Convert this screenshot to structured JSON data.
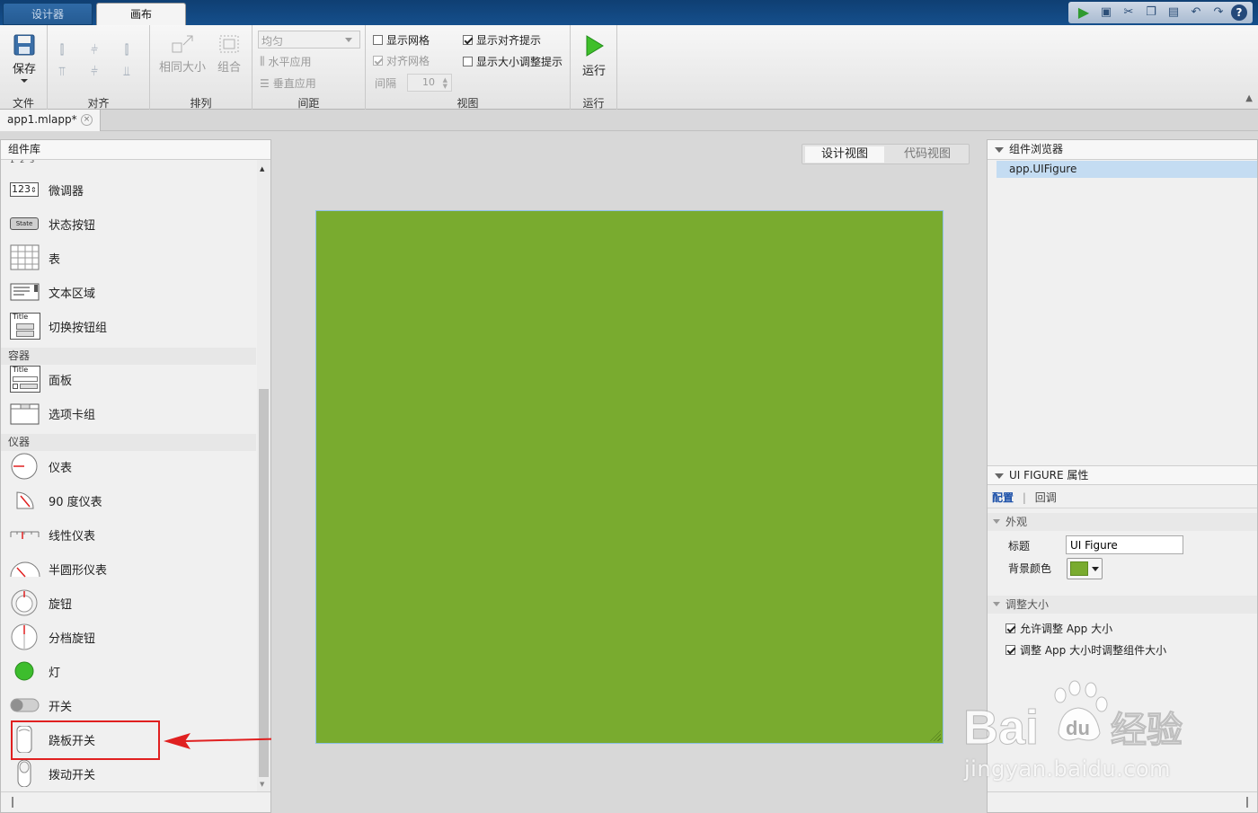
{
  "tabs": {
    "designer": "设计器",
    "canvas": "画布"
  },
  "ribbon": {
    "file": {
      "save": "保存",
      "group": "文件"
    },
    "align": {
      "group": "对齐"
    },
    "arrange": {
      "same_size": "相同大小",
      "group_btn": "组合",
      "group": "排列"
    },
    "spacing": {
      "even_dropdown": "均匀",
      "apply_horizontal": "水平应用",
      "apply_vertical": "垂直应用",
      "group": "间距"
    },
    "view": {
      "show_grid": "显示网格",
      "snap_grid": "对齐网格",
      "interval_label": "间隔",
      "interval_value": "10",
      "show_align_hints": "显示对齐提示",
      "show_resize_hints": "显示大小调整提示",
      "group": "视图"
    },
    "run": {
      "run": "运行",
      "group": "运行"
    }
  },
  "doc_tab": {
    "name": "app1.mlapp*"
  },
  "component_library": {
    "header": "组件库",
    "items_top": [
      {
        "label": "微调器",
        "icon": "spinner-icon"
      },
      {
        "label": "状态按钮",
        "icon": "state-button-icon",
        "icon_text": "State"
      },
      {
        "label": "表",
        "icon": "table-icon"
      },
      {
        "label": "文本区域",
        "icon": "text-area-icon"
      },
      {
        "label": "切换按钮组",
        "icon": "toggle-group-icon",
        "icon_text": "Title"
      }
    ],
    "spinner_icon_text": "123",
    "containers": {
      "category": "容器",
      "items": [
        {
          "label": "面板",
          "icon": "panel-icon",
          "icon_text": "Title"
        },
        {
          "label": "选项卡组",
          "icon": "tab-group-icon"
        }
      ]
    },
    "instruments": {
      "category": "仪器",
      "items": [
        {
          "label": "仪表",
          "icon": "gauge-icon"
        },
        {
          "label": "90 度仪表",
          "icon": "ninety-degree-gauge-icon"
        },
        {
          "label": "线性仪表",
          "icon": "linear-gauge-icon"
        },
        {
          "label": "半圆形仪表",
          "icon": "semicircular-gauge-icon"
        },
        {
          "label": "旋钮",
          "icon": "knob-icon"
        },
        {
          "label": "分档旋钮",
          "icon": "discrete-knob-icon"
        },
        {
          "label": "灯",
          "icon": "lamp-icon"
        },
        {
          "label": "开关",
          "icon": "switch-icon"
        },
        {
          "label": "跷板开关",
          "icon": "rocker-switch-icon"
        },
        {
          "label": "拨动开关",
          "icon": "toggle-switch-icon"
        }
      ]
    }
  },
  "canvas": {
    "view_design": "设计视图",
    "view_code": "代码视图",
    "figure_color": "#79ab2f"
  },
  "component_browser": {
    "header": "组件浏览器",
    "selected": "app.UIFigure"
  },
  "properties": {
    "header": "UI FIGURE 属性",
    "tab_config": "配置",
    "tab_separator": "|",
    "tab_callback": "回调",
    "appearance": {
      "section": "外观",
      "title_label": "标题",
      "title_value": "UI Figure",
      "bg_label": "背景颜色"
    },
    "resize": {
      "section": "调整大小",
      "allow_resize": "允许调整 App 大小",
      "resize_children": "调整 App 大小时调整组件大小"
    }
  },
  "colors": {
    "title_bar": "#154f8c",
    "figure_green": "#79ab2f",
    "highlight_red": "#e02020",
    "selection_blue": "#c4dcf2"
  },
  "watermark": {
    "brand": "Bai",
    "brand_paw": "du",
    "brand_cn": "经验",
    "url": "jingyan.baidu.com"
  }
}
